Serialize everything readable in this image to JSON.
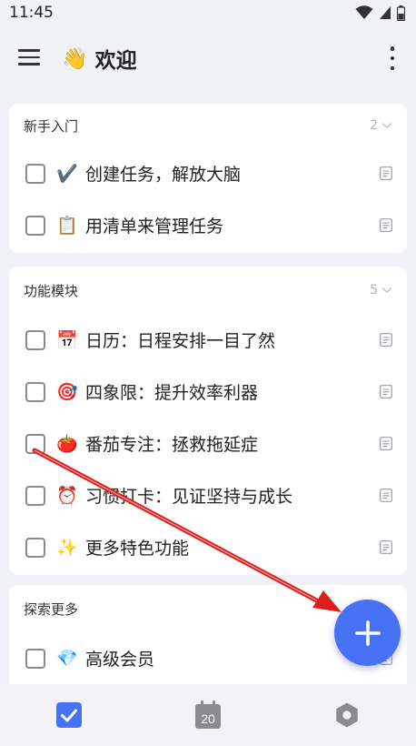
{
  "status_bar": {
    "time": "11:45",
    "icons": [
      "wifi-icon",
      "cellular-signal-icon",
      "battery-icon"
    ]
  },
  "app_bar": {
    "menu_icon": "hamburger-menu-icon",
    "title_emoji": "👋",
    "title": "欢迎",
    "more_icon": "more-vertical-icon"
  },
  "sections": [
    {
      "title": "新手入门",
      "count": "2",
      "tasks": [
        {
          "emoji": "✔️",
          "text": "创建任务，解放大脑"
        },
        {
          "emoji": "📋",
          "text": "用清单来管理任务"
        }
      ]
    },
    {
      "title": "功能模块",
      "count": "5",
      "tasks": [
        {
          "emoji": "📅",
          "text": "日历：日程安排一目了然"
        },
        {
          "emoji": "🎯",
          "text": "四象限：提升效率利器"
        },
        {
          "emoji": "🍅",
          "text": "番茄专注：拯救拖延症"
        },
        {
          "emoji": "⏰",
          "text": "习惯打卡：见证坚持与成长"
        },
        {
          "emoji": "✨",
          "text": "更多特色功能"
        }
      ]
    },
    {
      "title": "探索更多",
      "tasks": [
        {
          "emoji": "💎",
          "text": "高级会员"
        }
      ]
    }
  ],
  "bottom_nav": {
    "tasks_icon": "checkbox-tab-icon",
    "calendar_day": "20",
    "more_icon": "hexagon-settings-icon"
  },
  "fab": {
    "icon": "plus-icon"
  },
  "colors": {
    "accent": "#4772f6",
    "background": "#f1f2f6",
    "card": "#ffffff",
    "annotation_arrow": "#e01d1d"
  }
}
